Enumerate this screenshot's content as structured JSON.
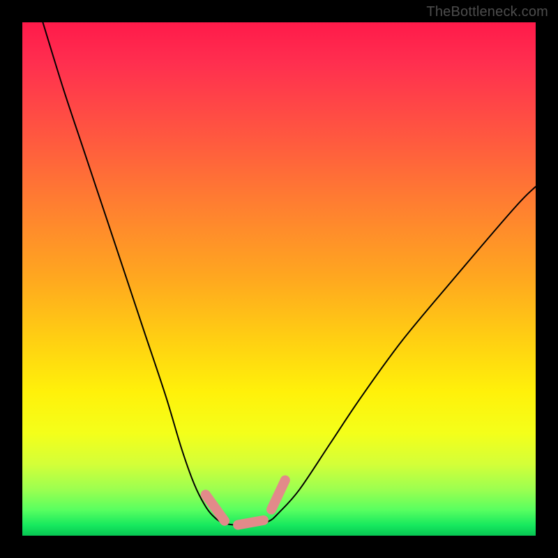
{
  "watermark": "TheBottleneck.com",
  "colors": {
    "frame": "#000000",
    "gradient_top": "#ff1a4a",
    "gradient_bottom": "#08c653",
    "curve": "#000000",
    "marker": "#e28a8a"
  },
  "chart_data": {
    "type": "line",
    "title": "",
    "xlabel": "",
    "ylabel": "",
    "xlim": [
      0,
      100
    ],
    "ylim": [
      0,
      100
    ],
    "grid": false,
    "legend": false,
    "note": "No axis ticks or numeric labels are rendered; values estimated from pixel positions on a 0–100 normalized grid (origin bottom-left). Background gradient encodes y (red≈100 top → green≈0 bottom). Curve is a V-shaped valley; pink dashed U marks the trough region.",
    "series": [
      {
        "name": "curve",
        "x": [
          4,
          8,
          12,
          16,
          20,
          24,
          28,
          31,
          33.5,
          35.5,
          37,
          39,
          42,
          45,
          48,
          50,
          54,
          60,
          66,
          74,
          84,
          96,
          100
        ],
        "y": [
          100,
          87,
          75,
          63,
          51,
          39,
          27,
          17,
          10,
          6,
          4,
          2.5,
          2,
          2,
          2.8,
          4.5,
          9,
          18,
          27,
          38,
          50,
          64,
          68
        ]
      }
    ],
    "annotations": [
      {
        "name": "valley-marker-dashed-U",
        "shape": "polyline",
        "style": "dashed",
        "points_x": [
          35.7,
          37.5,
          39.4,
          42.0,
          45.0,
          47.0,
          48.5,
          50.0,
          51.2
        ],
        "points_y": [
          8.0,
          4.6,
          2.9,
          2.1,
          2.1,
          3.0,
          5.1,
          7.6,
          10.8
        ]
      }
    ]
  }
}
